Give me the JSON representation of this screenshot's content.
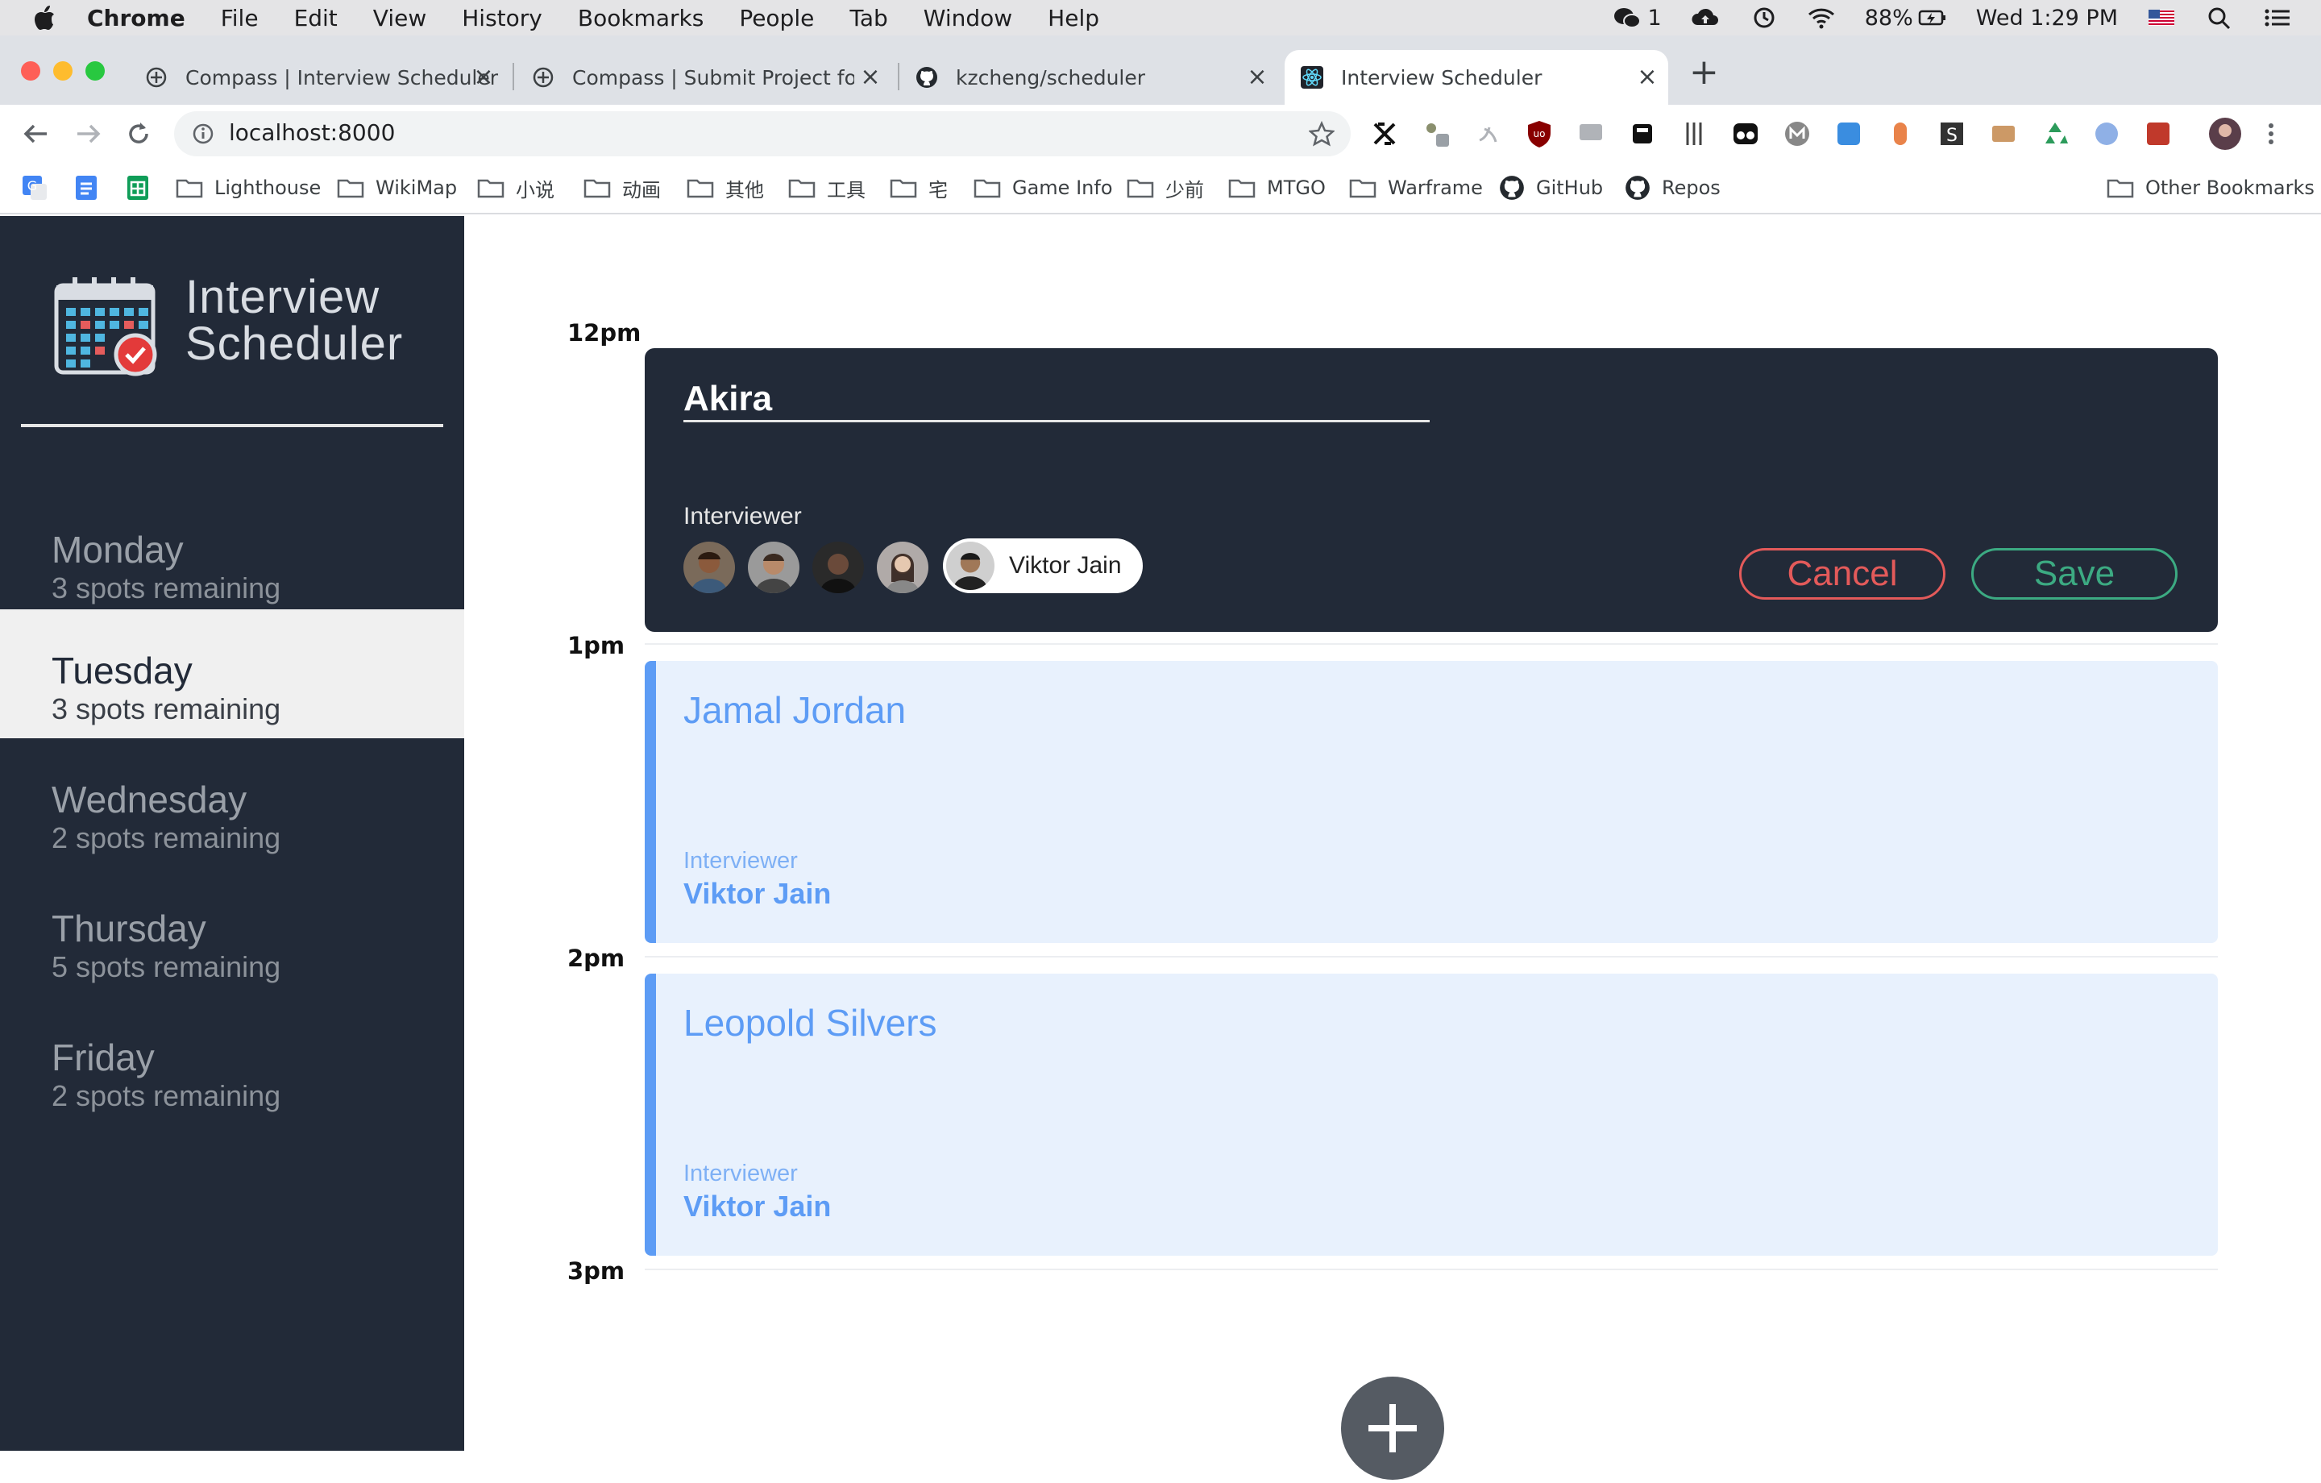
{
  "menubar": {
    "app_name": "Chrome",
    "items": [
      "File",
      "Edit",
      "View",
      "History",
      "Bookmarks",
      "People",
      "Tab",
      "Window",
      "Help"
    ],
    "wechat_count": "1",
    "battery": "88%",
    "clock": "Wed 1:29 PM"
  },
  "tabs": [
    {
      "title": "Compass | Interview Scheduler",
      "icon": "compass-icon"
    },
    {
      "title": "Compass | Submit Project for Ev",
      "icon": "compass-icon"
    },
    {
      "title": "kzcheng/scheduler",
      "icon": "github-icon"
    },
    {
      "title": "Interview Scheduler",
      "icon": "react-icon",
      "active": true
    }
  ],
  "address_bar": {
    "url": "localhost:8000"
  },
  "bookmarks": [
    {
      "label": "Lighthouse"
    },
    {
      "label": "WikiMap"
    },
    {
      "label": "小说"
    },
    {
      "label": "动画"
    },
    {
      "label": "其他"
    },
    {
      "label": "工具"
    },
    {
      "label": "宅"
    },
    {
      "label": "Game Info"
    },
    {
      "label": "少前"
    },
    {
      "label": "MTGO"
    },
    {
      "label": "Warframe"
    },
    {
      "label": "GitHub"
    },
    {
      "label": "Repos"
    }
  ],
  "other_bookmarks": "Other Bookmarks",
  "app": {
    "title_line1": "Interview",
    "title_line2": "Scheduler",
    "days": [
      {
        "name": "Monday",
        "spots": "3 spots remaining"
      },
      {
        "name": "Tuesday",
        "spots": "3 spots remaining",
        "selected": true
      },
      {
        "name": "Wednesday",
        "spots": "2 spots remaining"
      },
      {
        "name": "Thursday",
        "spots": "5 spots remaining"
      },
      {
        "name": "Friday",
        "spots": "2 spots remaining"
      }
    ],
    "times": [
      "12pm",
      "1pm",
      "2pm",
      "3pm"
    ],
    "form": {
      "student_name": "Akira",
      "interviewer_label": "Interviewer",
      "selected_interviewer": "Viktor Jain",
      "cancel_label": "Cancel",
      "save_label": "Save"
    },
    "appointments": [
      {
        "student": "Jamal Jordan",
        "interviewer_label": "Interviewer",
        "interviewer": "Viktor Jain"
      },
      {
        "student": "Leopold Silvers",
        "interviewer_label": "Interviewer",
        "interviewer": "Viktor Jain"
      }
    ]
  },
  "colors": {
    "sidebar_bg": "#222a38",
    "card_bg": "#e8f1fd",
    "card_accent": "#5d9cf5",
    "cancel": "#e35a5a",
    "save": "#3caa82"
  }
}
